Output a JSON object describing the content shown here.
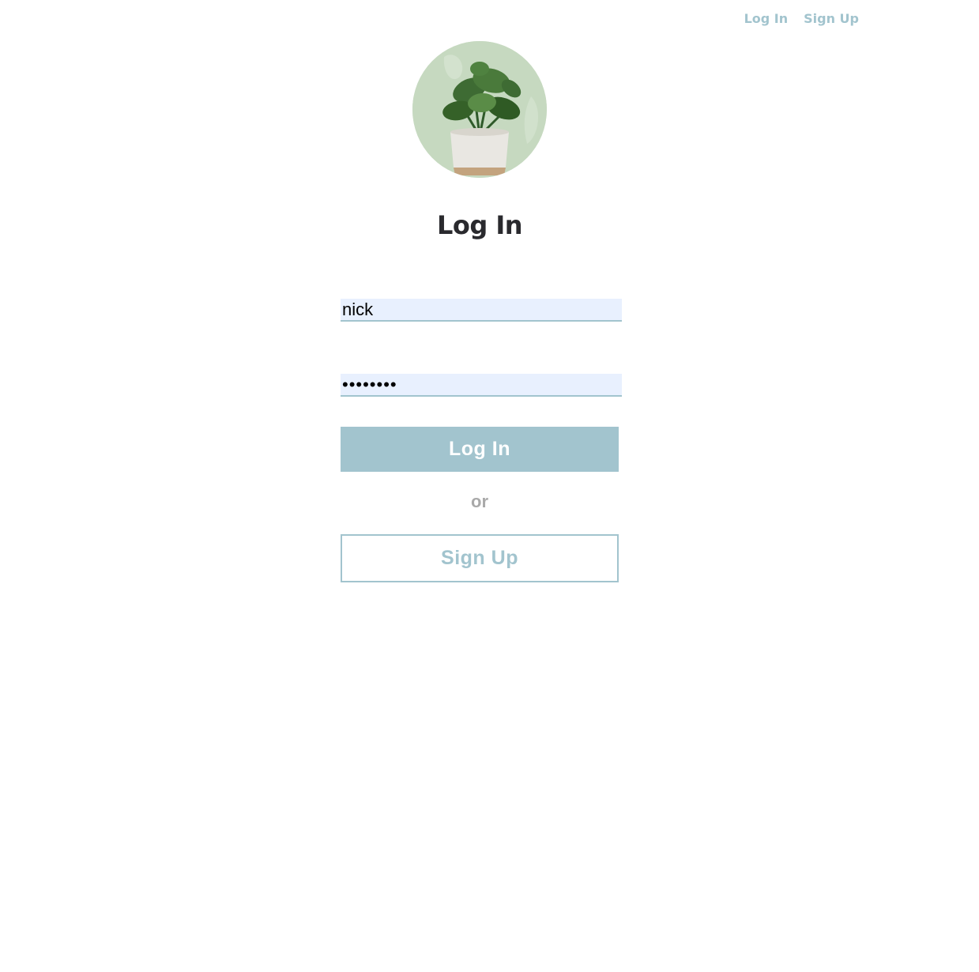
{
  "nav": {
    "login_label": "Log In",
    "signup_label": "Sign Up"
  },
  "logo": {
    "icon": "potted-plant-icon"
  },
  "heading": "Log In",
  "form": {
    "username_value": "nick",
    "password_value": "••••••••",
    "submit_label": "Log In",
    "separator": "or",
    "signup_label": "Sign Up"
  },
  "colors": {
    "accent": "#a2c4ce",
    "input_bg": "#e8f0fe",
    "heading": "#2a2a2e",
    "muted": "#a9a9a9",
    "logo_bg": "#c6d9c0"
  }
}
